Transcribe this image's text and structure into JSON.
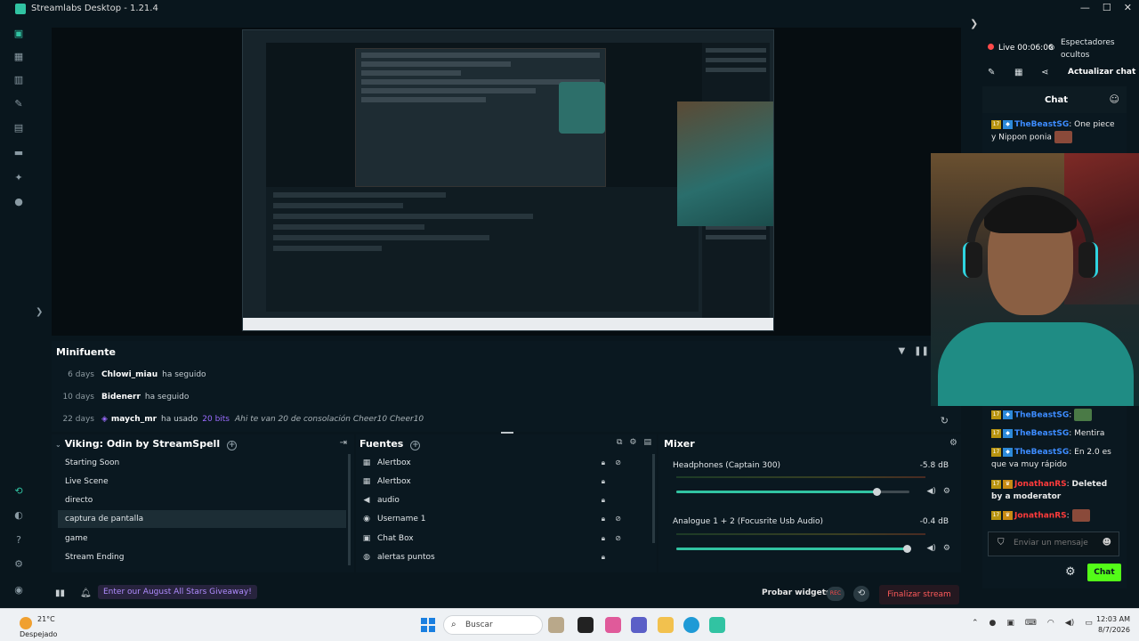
{
  "window": {
    "title": "Streamlabs Desktop - 1.21.4"
  },
  "minifeed": {
    "title": "Minifuente",
    "events": [
      {
        "age": "6 days",
        "user": "Chlowi_miau",
        "action": "ha seguido",
        "bits": "",
        "message": ""
      },
      {
        "age": "10 days",
        "user": "Bidenerr",
        "action": "ha seguido",
        "bits": "",
        "message": ""
      },
      {
        "age": "22 days",
        "user": "maych_mr",
        "action": "ha usado",
        "bits": "20 bits",
        "message": "Ahi te van 20 de consolación Cheer10 Cheer10"
      }
    ]
  },
  "scenes": {
    "title": "Viking: Odin by StreamSpell",
    "items": [
      "Starting Soon",
      "Live Scene",
      "directo",
      "captura de pantalla",
      "game",
      "Stream Ending"
    ],
    "selected": "captura de pantalla"
  },
  "sources": {
    "title": "Fuentes",
    "items": [
      {
        "name": "Alertbox",
        "icon": "alert-icon"
      },
      {
        "name": "Alertbox",
        "icon": "alert-icon"
      },
      {
        "name": "audio",
        "icon": "speaker-icon"
      },
      {
        "name": "Username 1",
        "icon": "user-icon"
      },
      {
        "name": "Chat Box",
        "icon": "chat-icon"
      },
      {
        "name": "alertas puntos",
        "icon": "globe-icon"
      }
    ]
  },
  "mixer": {
    "title": "Mixer",
    "channels": [
      {
        "name": "Headphones (Captain 300)",
        "db": "-5.8 dB",
        "level": 0.86
      },
      {
        "name": "Analogue 1 + 2 (Focusrite Usb Audio)",
        "db": "-0.4 dB",
        "level": 0.99
      }
    ]
  },
  "footer": {
    "giveaway": "Enter our August All Stars Giveaway!",
    "test_widgets": "Probar widgets",
    "rec": "REC",
    "end_stream": "Finalizar stream"
  },
  "rightpanel": {
    "live": "Live 00:06:06",
    "viewers_hidden": "Espectadores ocultos",
    "refresh_chat": "Actualizar chat",
    "chat_tab": "Chat",
    "messages": [
      {
        "user": "TheBeastSG",
        "sep": ":",
        "text": "One piece y Nippon ponia",
        "color": "blue"
      },
      {
        "user": "TheBeastSG",
        "sep": ":",
        "text": "",
        "color": "blue"
      },
      {
        "user": "TheBeastSG",
        "sep": ":",
        "text": "Mentira",
        "color": "blue"
      },
      {
        "user": "TheBeastSG",
        "sep": ":",
        "text": "En 2.0 es que va muy rápido",
        "color": "blue"
      },
      {
        "user": "JonathanRS",
        "sep": ":",
        "text": "Deleted by a moderator",
        "color": "red"
      },
      {
        "user": "JonathanRS",
        "sep": ":",
        "text": "",
        "color": "red"
      }
    ],
    "input_placeholder": "Enviar un mensaje",
    "send": "Chat"
  },
  "taskbar": {
    "temp": "21°C",
    "weather": "Despejado",
    "search": "Buscar",
    "time": "12:03 AM",
    "date": "8/7/2026"
  },
  "colors": {
    "accent": "#31c3a2",
    "live_red": "#ff4a4a",
    "kick_green": "#53fc18",
    "bits_purple": "#9b6bff"
  }
}
